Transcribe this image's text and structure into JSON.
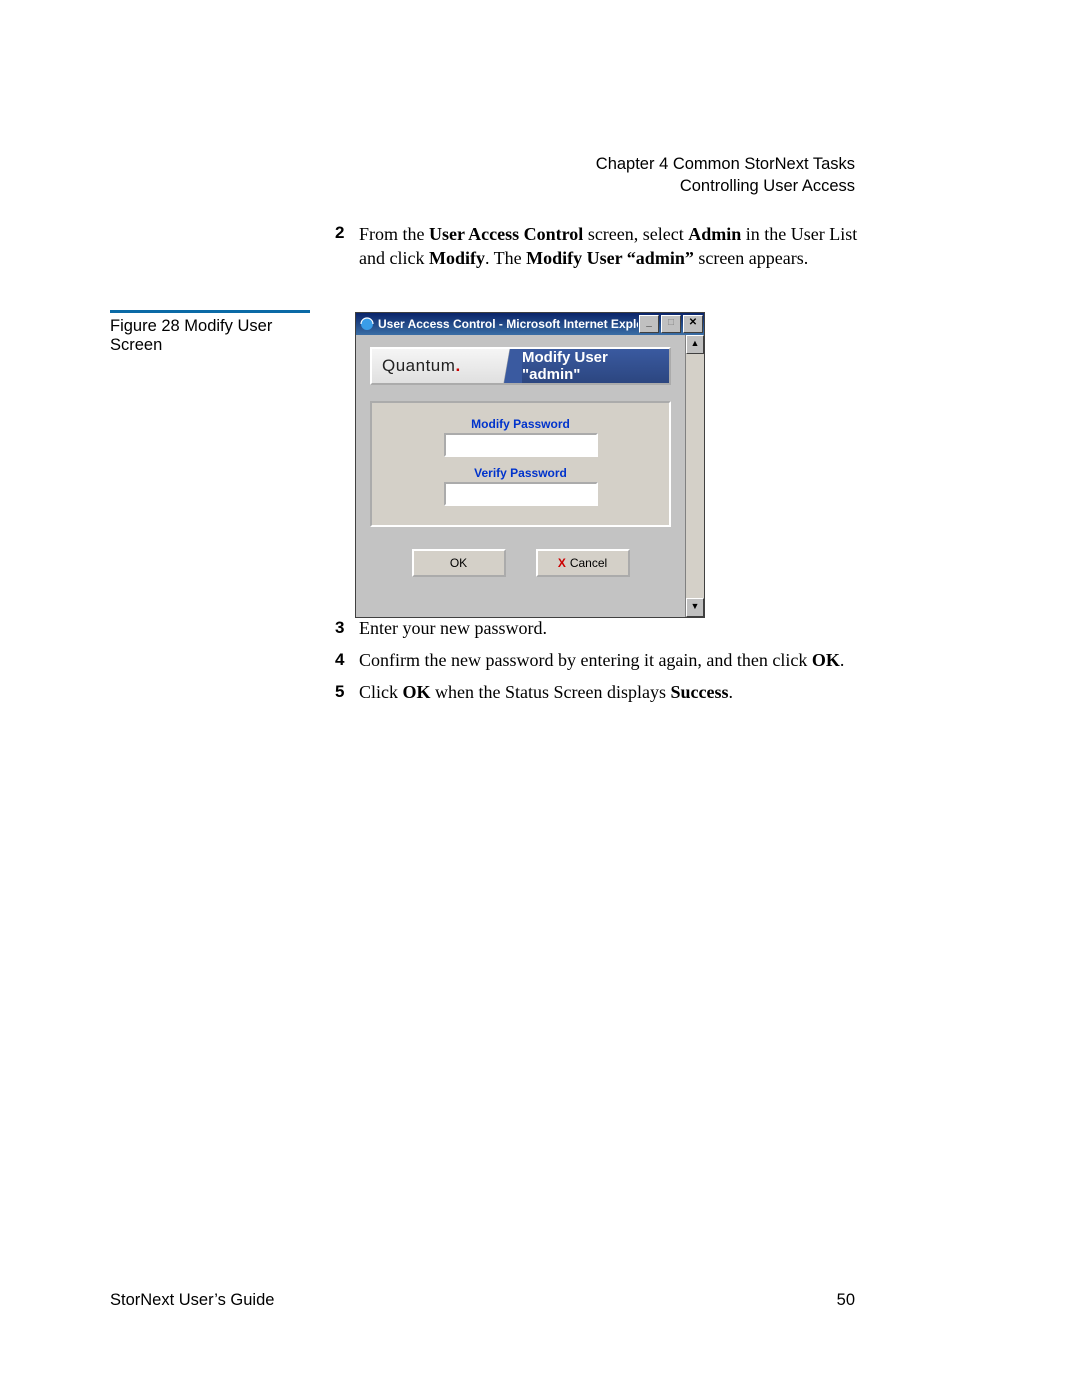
{
  "running_head": {
    "line1": "Chapter 4  Common StorNext Tasks",
    "line2": "Controlling User Access"
  },
  "step2": {
    "num": "2",
    "parts": [
      "From the ",
      "User Access Control",
      " screen, select ",
      "Admin",
      " in the User List and click ",
      "Modify",
      ". The ",
      "Modify User “admin”",
      " screen appears."
    ]
  },
  "figure_caption": "Figure 28  Modify User Screen",
  "ie": {
    "title": "User Access Control - Microsoft Internet Explorer",
    "min": "_",
    "max": "□",
    "close": "✕",
    "up": "▲",
    "down": "▼"
  },
  "app": {
    "logo": "Quantum",
    "header_title": "Modify User \"admin\"",
    "label_modify": "Modify Password",
    "label_verify": "Verify Password",
    "btn_ok": "OK",
    "btn_cancel": "Cancel",
    "cancel_x": "X"
  },
  "steps_after": [
    {
      "num": "3",
      "text": "Enter your new password."
    },
    {
      "num": "4",
      "parts": [
        "Confirm the new password by entering it again, and then click ",
        "OK",
        "."
      ]
    },
    {
      "num": "5",
      "parts": [
        "Click ",
        "OK",
        " when the Status Screen displays ",
        "Success",
        "."
      ]
    }
  ],
  "footer": {
    "left": "StorNext User’s Guide",
    "right": "50"
  }
}
